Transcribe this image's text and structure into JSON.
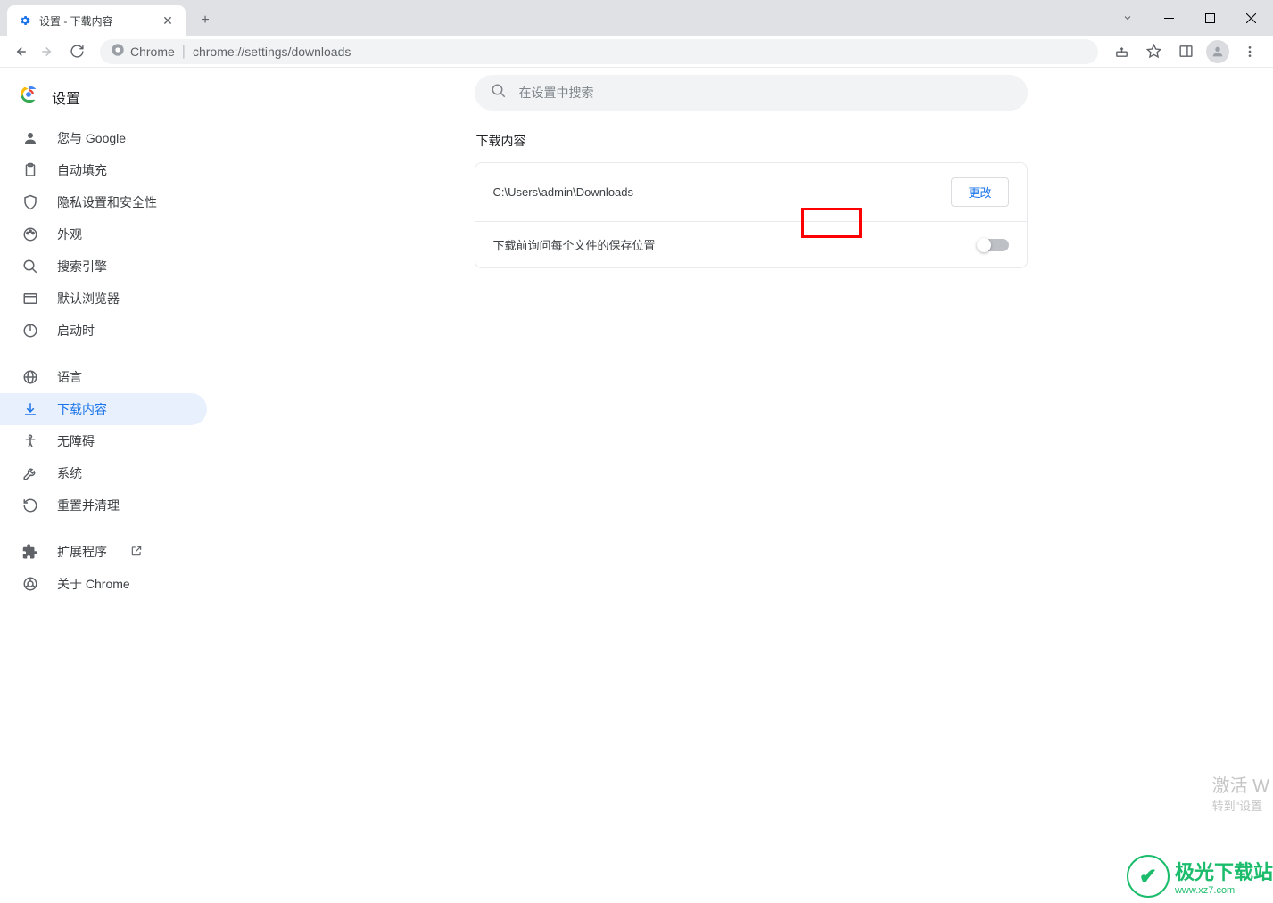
{
  "window": {
    "tab_title": "设置 - 下载内容"
  },
  "omnibox": {
    "chip_label": "Chrome",
    "url": "chrome://settings/downloads"
  },
  "sidebar": {
    "title": "设置",
    "items": [
      {
        "label": "您与 Google"
      },
      {
        "label": "自动填充"
      },
      {
        "label": "隐私设置和安全性"
      },
      {
        "label": "外观"
      },
      {
        "label": "搜索引擎"
      },
      {
        "label": "默认浏览器"
      },
      {
        "label": "启动时"
      }
    ],
    "items2": [
      {
        "label": "语言"
      },
      {
        "label": "下载内容"
      },
      {
        "label": "无障碍"
      },
      {
        "label": "系统"
      },
      {
        "label": "重置并清理"
      }
    ],
    "items3": [
      {
        "label": "扩展程序"
      },
      {
        "label": "关于 Chrome"
      }
    ]
  },
  "search": {
    "placeholder": "在设置中搜索"
  },
  "downloads": {
    "section_title": "下载内容",
    "location_path": "C:\\Users\\admin\\Downloads",
    "change_button": "更改",
    "ask_label": "下载前询问每个文件的保存位置",
    "ask_value": false
  },
  "watermark": {
    "activate_l1": "激活 W",
    "activate_l2": "转到\"设置",
    "site_name": "极光下载站",
    "site_url": "www.xz7.com"
  }
}
